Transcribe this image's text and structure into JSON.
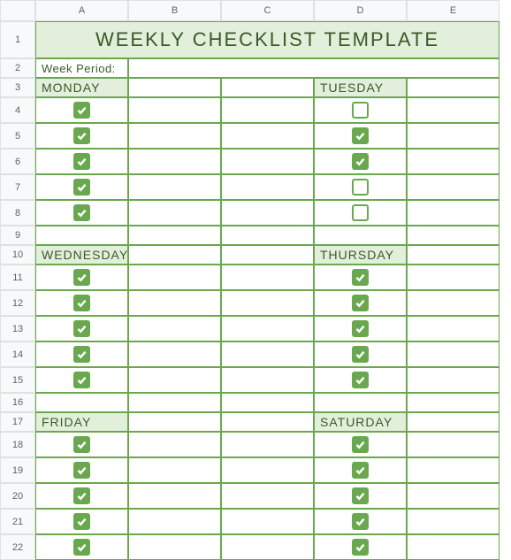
{
  "columns": [
    "A",
    "B",
    "C",
    "D",
    "E"
  ],
  "title": "WEEKLY CHECKLIST TEMPLATE",
  "week_period_label": "Week Period:",
  "week_period_value": "",
  "sections": [
    {
      "row": 3,
      "left": "MONDAY",
      "right": "TUESDAY"
    },
    {
      "row": 10,
      "left": "WEDNESDAY",
      "right": "THURSDAY"
    },
    {
      "row": 17,
      "left": "FRIDAY",
      "right": "SATURDAY"
    }
  ],
  "checks": {
    "4": {
      "A": true,
      "D": false
    },
    "5": {
      "A": true,
      "D": true
    },
    "6": {
      "A": true,
      "D": true
    },
    "7": {
      "A": true,
      "D": false
    },
    "8": {
      "A": true,
      "D": false
    },
    "11": {
      "A": true,
      "D": true
    },
    "12": {
      "A": true,
      "D": true
    },
    "13": {
      "A": true,
      "D": true
    },
    "14": {
      "A": true,
      "D": true
    },
    "15": {
      "A": true,
      "D": true
    },
    "18": {
      "A": true,
      "D": true
    },
    "19": {
      "A": true,
      "D": true
    },
    "20": {
      "A": true,
      "D": true
    },
    "21": {
      "A": true,
      "D": true
    },
    "22": {
      "A": true,
      "D": true
    }
  },
  "row_labels": [
    "1",
    "2",
    "3",
    "4",
    "5",
    "6",
    "7",
    "8",
    "9",
    "10",
    "11",
    "12",
    "13",
    "14",
    "15",
    "16",
    "17",
    "18",
    "19",
    "20",
    "21",
    "22"
  ]
}
